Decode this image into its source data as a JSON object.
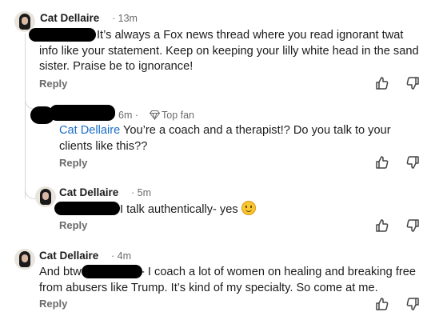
{
  "comments": [
    {
      "author": "Cat Dellaire",
      "time": "· 13m",
      "line1": "It’s always a Fox news thread where you read ignorant twat",
      "line2": "info like your statement. Keep on keeping your lilly white head in the sand",
      "line3": "sister. Praise be to ignorance!",
      "reply_label": "Reply"
    },
    {
      "author": "",
      "time": "6m ·",
      "badge_label": "Top fan",
      "badge_icon": "diamond-icon",
      "mention": "Cat Dellaire",
      "line1_rest": " You’re a coach and a therapist!? Do you talk to your",
      "line2": "clients like this??",
      "reply_label": "Reply"
    },
    {
      "author": "Cat Dellaire",
      "time": "· 5m",
      "line1": "I talk authentically- yes",
      "emoji": "smiling-face-emoji",
      "reply_label": "Reply"
    },
    {
      "author": "Cat Dellaire",
      "time": "· 4m",
      "line1_prefix": "And btw",
      "line1_rest": "- I coach a lot of women on healing and breaking free",
      "line2": "from abusers like Trump. It’s kind of my specialty. So come at me.",
      "reply_label": "Reply"
    }
  ],
  "icons": {
    "like": "thumbs-up-icon",
    "dislike": "thumbs-down-icon"
  }
}
